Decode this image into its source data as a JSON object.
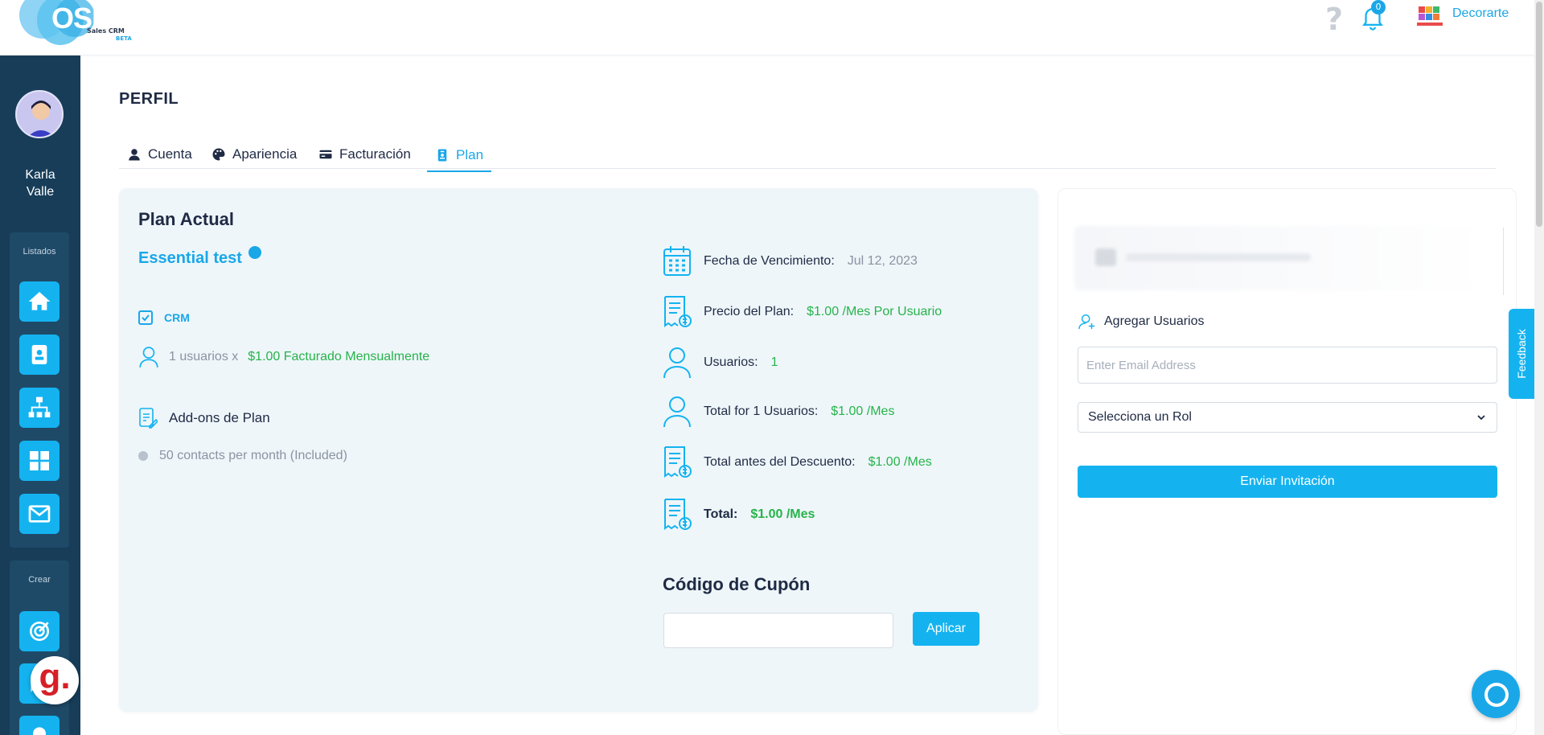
{
  "app": {
    "brand": "OSMOS",
    "brand_sub": "Sales CRM",
    "brand_beta": "BETA"
  },
  "header": {
    "help_icon": "question-icon",
    "notifications_count": "0",
    "company_name": "Decorarte"
  },
  "sidebar": {
    "user_name_first": "Karla",
    "user_name_last": "Valle",
    "group_listados": "Listados",
    "group_crear": "Crear",
    "listados_items": [
      "home-icon",
      "contacts-icon",
      "org-chart-icon",
      "dashboard-icon",
      "mail-icon"
    ],
    "crear_items": [
      "target-icon",
      "chat-icon",
      "bulb-icon"
    ]
  },
  "page": {
    "title": "PERFIL"
  },
  "tabs": [
    {
      "label": "Cuenta",
      "icon": "user-icon"
    },
    {
      "label": "Apariencia",
      "icon": "palette-icon"
    },
    {
      "label": "Facturación",
      "icon": "card-icon"
    },
    {
      "label": "Plan",
      "icon": "id-badge-icon",
      "active": true
    }
  ],
  "plan": {
    "heading": "Plan Actual",
    "name": "Essential test",
    "module": "CRM",
    "users_prefix": "1 usuarios x",
    "users_billing": "$1.00 Facturado Mensualmente",
    "addons_title": "Add-ons de Plan",
    "addon_item": "50 contacts per month (Included)"
  },
  "details": {
    "due_label": "Fecha de Vencimiento:",
    "due_value": "Jul 12, 2023",
    "price_label": "Precio del Plan:",
    "price_value": "$1.00 /Mes  Por Usuario",
    "users_label": "Usuarios:",
    "users_value": "1",
    "total_users_label": "Total for 1 Usuarios:",
    "total_users_value": "$1.00 /Mes",
    "pre_discount_label": "Total antes del Descuento:",
    "pre_discount_value": "$1.00 /Mes",
    "total_label": "Total:",
    "total_value": "$1.00 /Mes"
  },
  "coupon": {
    "title": "Código de Cupón",
    "value": "",
    "apply": "Aplicar"
  },
  "invite": {
    "title": "Agregar Usuarios",
    "email_placeholder": "Enter Email Address",
    "role_selected": "Selecciona un Rol",
    "send": "Enviar Invitación"
  },
  "feedback": "Feedback",
  "colors": {
    "accent": "#14b3f0",
    "sidebar": "#173d59",
    "success": "#27b34a"
  }
}
